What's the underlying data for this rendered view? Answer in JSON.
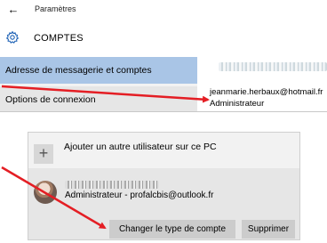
{
  "window": {
    "back_glyph": "←",
    "title": "Paramètres"
  },
  "header": {
    "icon": "gear-icon",
    "title": "COMPTES"
  },
  "sidebar": {
    "items": [
      {
        "label": "Adresse de messagerie et comptes",
        "selected": true
      },
      {
        "label": "Options de connexion",
        "selected": false
      }
    ]
  },
  "account_top": {
    "email": "jeanmarie.herbaux@hotmail.fr",
    "role": "Administrateur"
  },
  "other_users": {
    "add_icon": "plus-icon",
    "add_glyph": "+",
    "add_label": "Ajouter un autre utilisateur sur ce PC",
    "account_line": "Administrateur - profalcbis@outlook.fr",
    "change_type_button": "Changer le type de compte",
    "delete_button": "Supprimer"
  },
  "annotation": {
    "arrow_color": "#e41e24",
    "accent_selected": "#a9c5e6"
  }
}
